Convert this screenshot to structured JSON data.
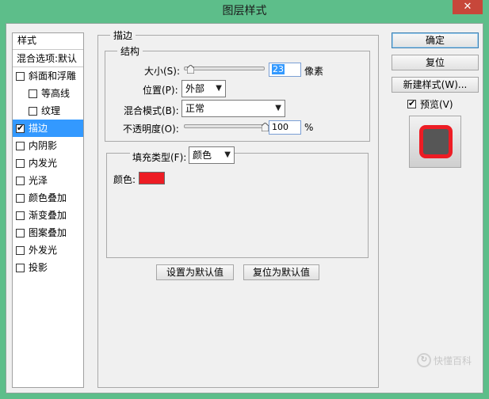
{
  "window": {
    "title": "图层样式",
    "close_glyph": "✕"
  },
  "styles_panel": {
    "header": "样式",
    "blend_options": "混合选项:默认",
    "items": [
      {
        "label": "斜面和浮雕",
        "checked": false,
        "sub": false
      },
      {
        "label": "等高线",
        "checked": false,
        "sub": true
      },
      {
        "label": "纹理",
        "checked": false,
        "sub": true
      },
      {
        "label": "描边",
        "checked": true,
        "sub": false,
        "selected": true
      },
      {
        "label": "内阴影",
        "checked": false,
        "sub": false
      },
      {
        "label": "内发光",
        "checked": false,
        "sub": false
      },
      {
        "label": "光泽",
        "checked": false,
        "sub": false
      },
      {
        "label": "颜色叠加",
        "checked": false,
        "sub": false
      },
      {
        "label": "渐变叠加",
        "checked": false,
        "sub": false
      },
      {
        "label": "图案叠加",
        "checked": false,
        "sub": false
      },
      {
        "label": "外发光",
        "checked": false,
        "sub": false
      },
      {
        "label": "投影",
        "checked": false,
        "sub": false
      }
    ]
  },
  "stroke": {
    "group_title": "描边",
    "structure_title": "结构",
    "size_label": "大小(S):",
    "size_value": "23",
    "size_unit": "像素",
    "size_slider_fraction": 0.08,
    "position_label": "位置(P):",
    "position_value": "外部",
    "blend_label": "混合模式(B):",
    "blend_value": "正常",
    "opacity_label": "不透明度(O):",
    "opacity_value": "100",
    "opacity_unit": "%",
    "opacity_fraction": 1.0,
    "fill_type_label": "填充类型(F):",
    "fill_type_value": "颜色",
    "color_label": "颜色:",
    "color_value": "#ed1c24",
    "set_default_button": "设置为默认值",
    "reset_default_button": "复位为默认值"
  },
  "right_panel": {
    "ok_button": "确定",
    "reset_button": "复位",
    "new_style_button": "新建样式(W)...",
    "preview_label": "预览(V)",
    "preview_checked": true
  },
  "watermark": {
    "text": "快懂百科"
  },
  "colors": {
    "title_bar": "#5dbe8a",
    "selection": "#3399ff",
    "stroke_color": "#ed1c24",
    "close_button": "#c7473a"
  }
}
